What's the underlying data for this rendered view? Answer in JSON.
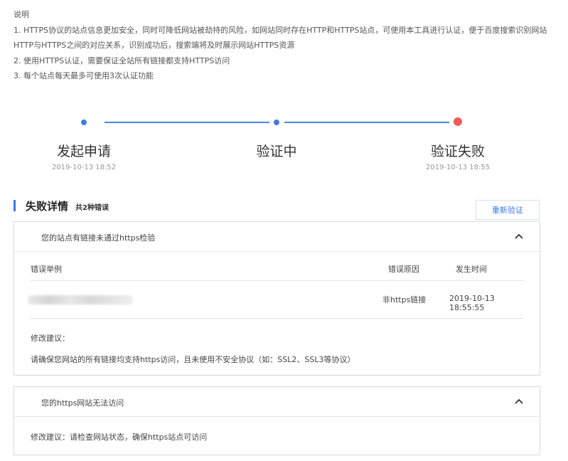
{
  "notes": {
    "heading": "说明",
    "line1": "1. HTTPS协议的站点信息更加安全，同时可降低网站被劫持的风险，如网站同时存在HTTP和HTTPS站点，可使用本工具进行认证，便于百度搜索识别网站",
    "line1b": "HTTP与HTTPS之间的对应关系，识别成功后，搜索端将及时展示网站HTTPS资源",
    "line2": "2. 使用HTTPS认证，需要保证全站所有链接都支持HTTPS访问",
    "line3": "3. 每个站点每天最多可使用3次认证功能"
  },
  "steps": [
    {
      "title": "发起申请",
      "time": "2019-10-13 18:52",
      "status_color": "#3d7be0"
    },
    {
      "title": "验证中",
      "time": "",
      "status_color": "#3d7be0"
    },
    {
      "title": "验证失败",
      "time": "2019-10-13 18:55",
      "status_color": "#f05a5a"
    }
  ],
  "failure": {
    "title": "失败详情",
    "count": "共2种错误",
    "reverify_label": "重新验证"
  },
  "panel1": {
    "title": "您的站点有链接未通过https检验",
    "columns": [
      "错误举例",
      "错误原因",
      "发生时间"
    ],
    "rows": [
      {
        "example": "",
        "reason": "非https链接",
        "time": "2019-10-13 18:55:55"
      }
    ],
    "suggest_label": "修改建议：",
    "suggest_text": "请确保您网站的所有链接均支持https访问，且未使用不安全协议（如：SSL2、SSL3等协议）"
  },
  "panel2": {
    "title": "您的https网站无法访问",
    "suggest_text": "修改建议：请检查网站状态，确保https站点可访问"
  },
  "colors": {
    "accent": "#3d7be0",
    "error": "#f05a5a"
  }
}
